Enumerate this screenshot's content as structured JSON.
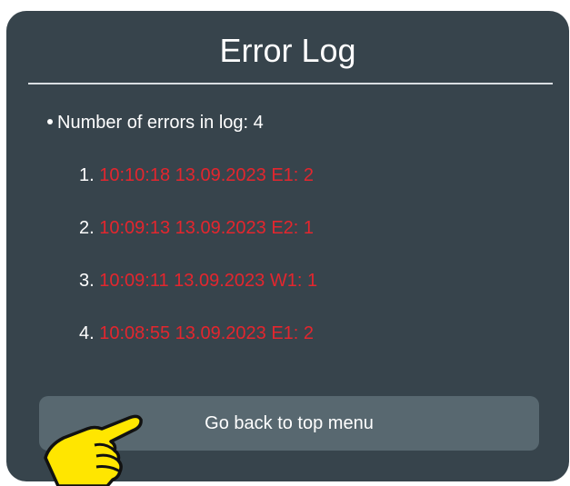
{
  "panel": {
    "title": "Error Log",
    "summary": "Number of errors in log: 4",
    "entries": [
      {
        "num": "1.",
        "text": "10:10:18 13.09.2023 E1: 2"
      },
      {
        "num": "2.",
        "text": "10:09:13 13.09.2023 E2: 1"
      },
      {
        "num": "3.",
        "text": "10:09:11 13.09.2023 W1: 1"
      },
      {
        "num": "4.",
        "text": "10:08:55 13.09.2023 E1: 2"
      }
    ],
    "back_button_label": "Go back to top menu"
  },
  "colors": {
    "panel_background": "#37444c",
    "error_text": "#e3262e",
    "button_background": "#586870",
    "pointer_hand": "#ffe600"
  },
  "icons": {
    "pointer": "pointing-hand-icon"
  }
}
